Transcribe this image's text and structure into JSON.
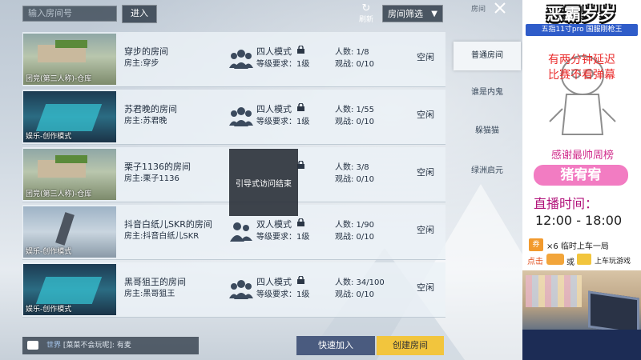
{
  "top_bar": {
    "room_search_placeholder": "输入房间号",
    "enter_label": "进入",
    "refresh_label": "刷新",
    "filter_label": "房间筛选"
  },
  "rooms": [
    {
      "thumb_caption": "团竞(第三人称)-仓库",
      "name": "穿步的房间",
      "owner": "房主:穿步",
      "mode": "四人模式",
      "level": "等级要求：1级",
      "players": "人数: 1/8",
      "spectators": "观战: 0/10",
      "status": "空闲"
    },
    {
      "thumb_caption": "娱乐-创作模式",
      "name": "苏君晚的房间",
      "owner": "房主:苏君晚",
      "mode": "四人模式",
      "level": "等级要求：1级",
      "players": "人数: 1/55",
      "spectators": "观战: 0/10",
      "status": "空闲"
    },
    {
      "thumb_caption": "团竞(第三人称)-仓库",
      "name": "栗子1136的房间",
      "owner": "房主:栗子1136",
      "mode": "",
      "level": "",
      "players": "人数: 3/8",
      "spectators": "观战: 0/10",
      "status": "空闲"
    },
    {
      "thumb_caption": "娱乐-创作模式",
      "name": "抖音白纸儿SKR的房间",
      "owner": "房主:抖音白纸儿SKR",
      "mode": "双人模式",
      "level": "等级要求：1级",
      "players": "人数: 1/90",
      "spectators": "观战: 0/10",
      "status": "空闲"
    },
    {
      "thumb_caption": "娱乐-创作模式",
      "name": "黑哥狙王的房间",
      "owner": "房主:黑哥狙王",
      "mode": "四人模式",
      "level": "等级要求：1级",
      "players": "人数: 34/100",
      "spectators": "观战: 0/10",
      "status": "空闲"
    }
  ],
  "toast": "引导式访问结束",
  "tabs": {
    "header": "房间",
    "items": [
      "普通房间",
      "谁是内鬼",
      "躲猫猫",
      "绿洲启元"
    ],
    "active_index": 0
  },
  "chat": {
    "channel": "世界",
    "message": "[菜菜不会玩呢]: 有麦"
  },
  "buttons": {
    "quick_join": "快速加入",
    "create_room": "创建房间"
  },
  "overlay": {
    "title": "恶霸岁岁",
    "badge": "五指11寸pro 国服刚枪王",
    "notice_line1": "有两分钟延迟",
    "notice_line2": "比赛不看弹幕",
    "thanks": "感谢最帅周榜",
    "supporter": "猪宥宥",
    "time_label": "直播时间：",
    "time_value": "12:00 - 18:00",
    "ticket_icon": "券",
    "ticket_text": "×6 临时上车一局",
    "click_label": "点击",
    "or_label": "或",
    "ride_label": "上车玩游戏"
  },
  "colors": {
    "create_room_bg": "#f2c53d",
    "quick_join_bg": "#4a5b7f",
    "overlay_notice": "#ea2b2b"
  }
}
